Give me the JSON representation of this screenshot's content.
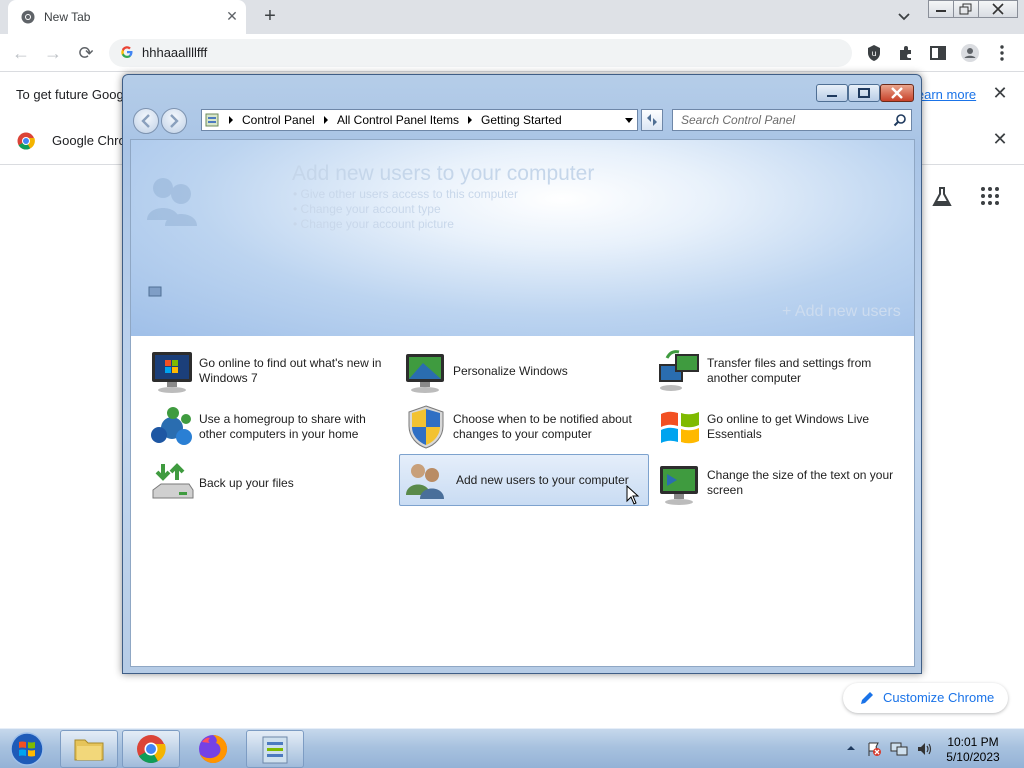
{
  "browser": {
    "tab_title": "New Tab",
    "address": "hhhaaallllfff",
    "infobar1_text": "To get future Goog",
    "infobar1_link": "learn more",
    "infobar2_text": "Google Chro",
    "customize_label": "Customize Chrome"
  },
  "control_panel": {
    "breadcrumbs": [
      "Control Panel",
      "All Control Panel Items",
      "Getting Started"
    ],
    "search_placeholder": "Search Control Panel",
    "hero": {
      "title": "Add new users to your computer",
      "bullets": [
        "Give other users access to this computer",
        "Change your account type",
        "Change your account picture"
      ],
      "action": "Add new users"
    },
    "items": [
      {
        "label": "Go online to find out what's new in Windows 7",
        "icon": "monitor-windows-icon"
      },
      {
        "label": "Personalize Windows",
        "icon": "personalize-monitor-icon"
      },
      {
        "label": "Transfer files and settings from another computer",
        "icon": "transfer-computers-icon"
      },
      {
        "label": "Use a homegroup to share with other computers in your home",
        "icon": "homegroup-icon"
      },
      {
        "label": "Choose when to be notified about changes to your computer",
        "icon": "uac-shield-icon"
      },
      {
        "label": "Go online to get Windows Live Essentials",
        "icon": "windows-flag-icon"
      },
      {
        "label": "Back up your files",
        "icon": "backup-drive-icon"
      },
      {
        "label": "Add new users to your computer",
        "icon": "users-icon",
        "selected": true
      },
      {
        "label": "Change the size of the text on your screen",
        "icon": "text-size-monitor-icon"
      }
    ]
  },
  "taskbar": {
    "time": "10:01 PM",
    "date": "5/10/2023"
  }
}
